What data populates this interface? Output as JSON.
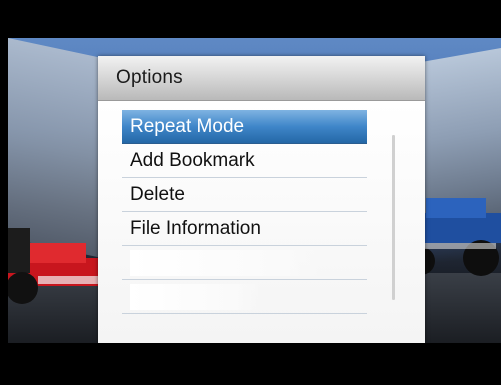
{
  "dialog": {
    "title": "Options",
    "items": [
      {
        "label": "Repeat Mode",
        "selected": true
      },
      {
        "label": "Add Bookmark",
        "selected": false
      },
      {
        "label": "Delete",
        "selected": false
      },
      {
        "label": "File Information",
        "selected": false
      },
      {
        "label": "",
        "selected": false
      },
      {
        "label": "",
        "selected": false
      }
    ]
  },
  "colors": {
    "selection": "#3f86c9",
    "header": "#d9d9d9",
    "background_sky": "#4a74b6"
  },
  "icons": {
    "background_left": "race-car-red",
    "background_right": "race-car-blue"
  }
}
